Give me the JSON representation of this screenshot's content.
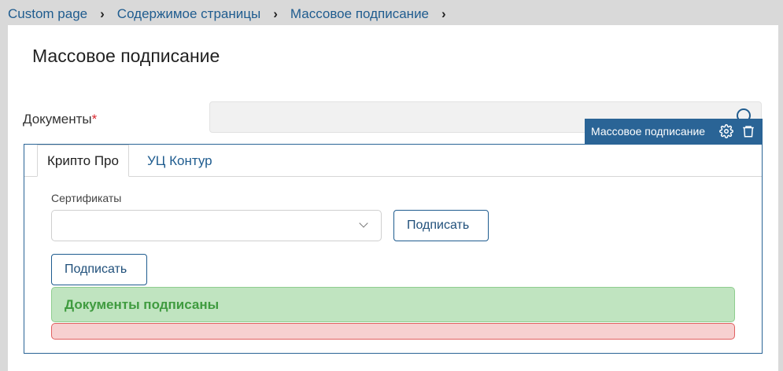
{
  "breadcrumb": [
    "Custom page",
    "Содержимое страницы",
    "Массовое подписание"
  ],
  "page_title": "Массовое подписание",
  "documents_field": {
    "label": "Документы",
    "required_mark": "*",
    "value": ""
  },
  "widget_toolbar": {
    "name": "Массовое подписание",
    "icons": [
      "gear-icon",
      "trash-icon"
    ]
  },
  "tabs": [
    {
      "label": "Крипто Про",
      "active": true
    },
    {
      "label": "УЦ Контур",
      "active": false
    }
  ],
  "certificates": {
    "label": "Сертификаты",
    "value": ""
  },
  "sign_button_label": "Подписать",
  "sign_button2_label": "Подписать",
  "success_message": "Документы подписаны",
  "colors": {
    "accent": "#2a6496",
    "link": "#1f5c8f",
    "success_bg": "#c0e4c0",
    "error_bg": "#f7d0d0"
  }
}
